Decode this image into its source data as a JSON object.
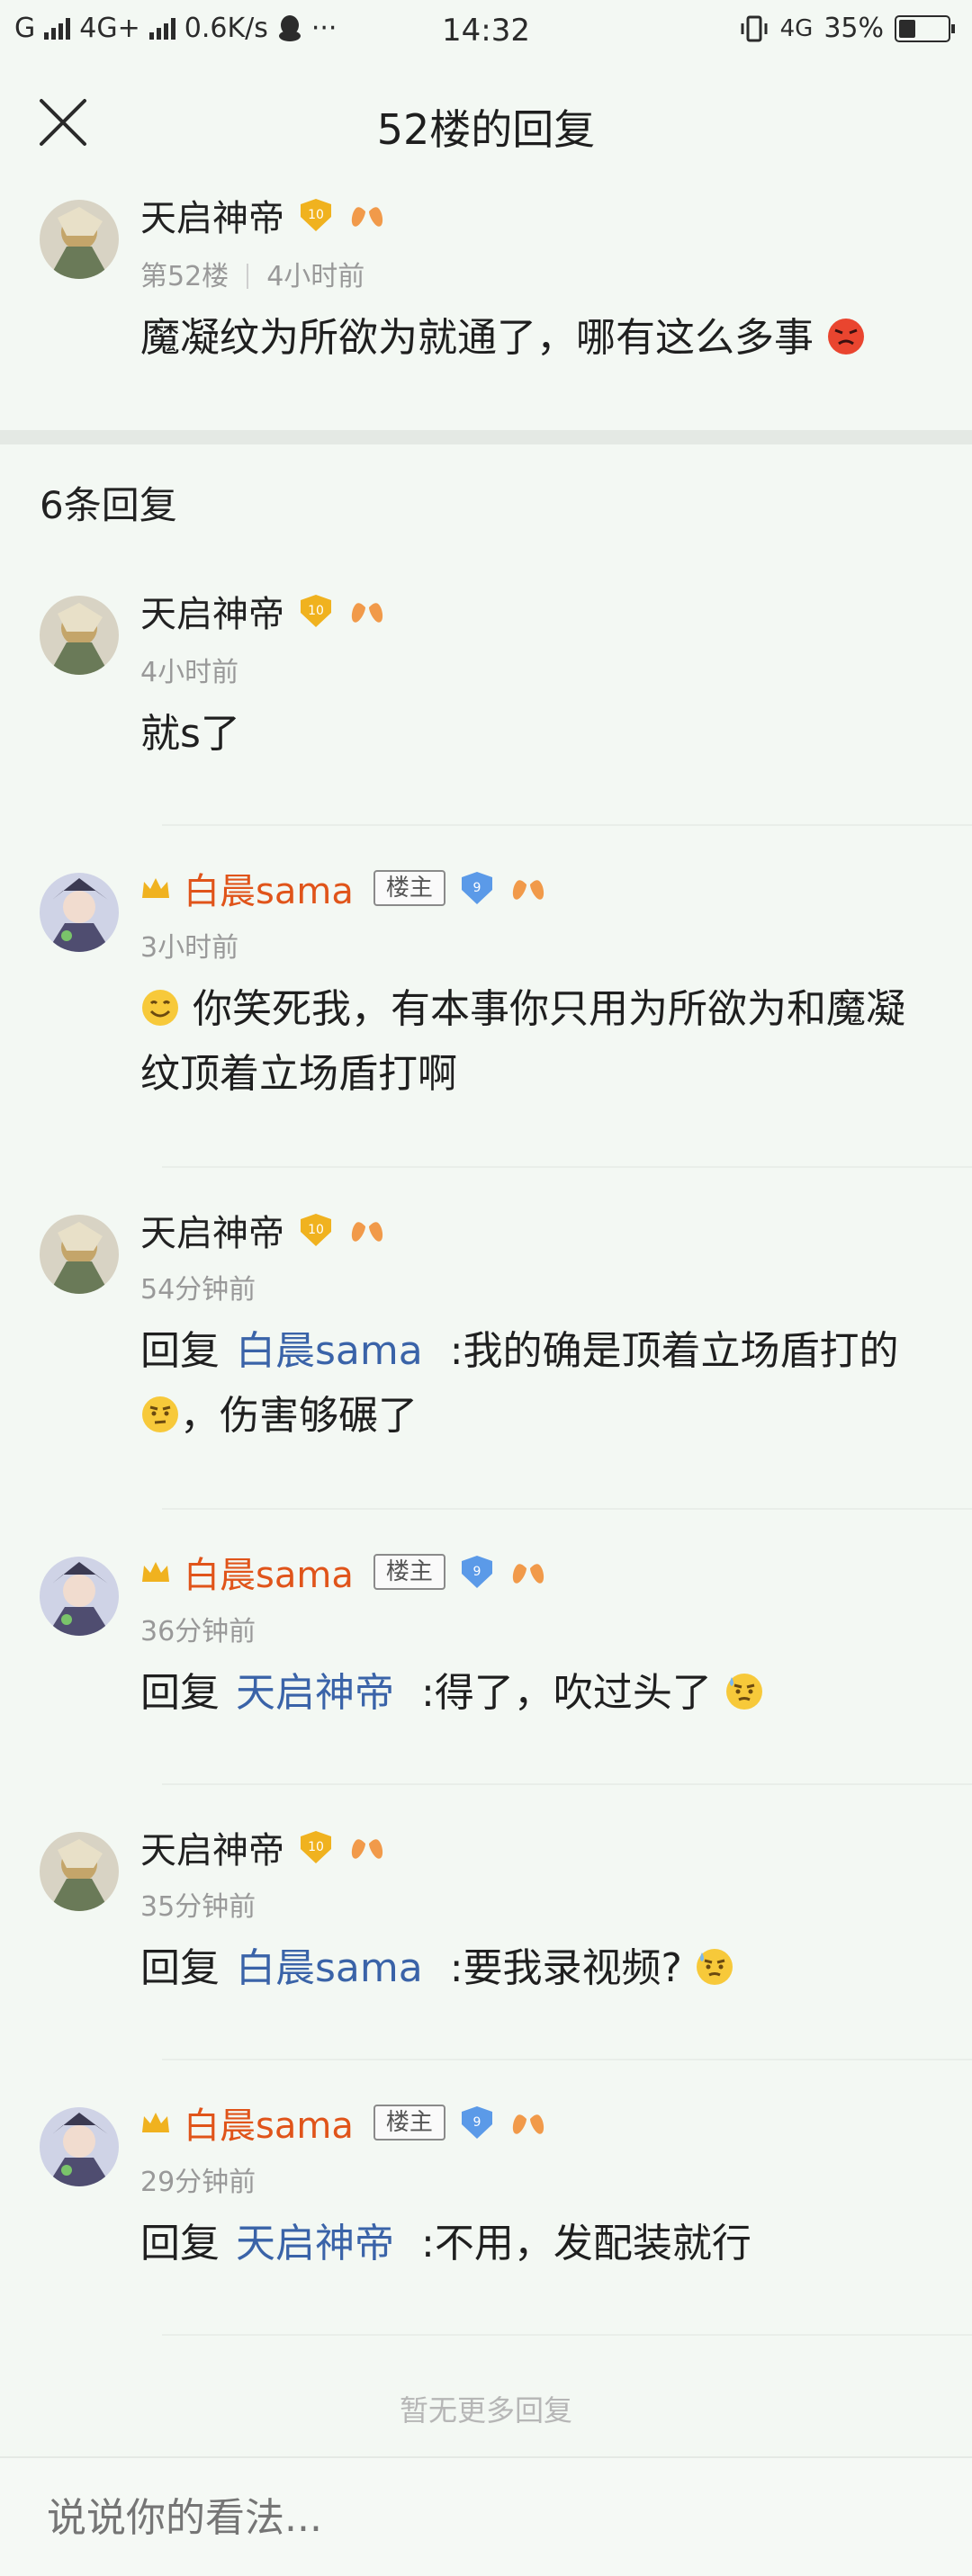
{
  "status_bar": {
    "left_text": "G",
    "network": "4G+",
    "speed": "0.6K/s",
    "more": "···",
    "time": "14:32",
    "net_right": "4G",
    "battery": "35%",
    "battery_level": 0.35
  },
  "nav": {
    "title": "52楼的回复",
    "close_icon": "close-icon"
  },
  "main_post": {
    "user": "天启神帝",
    "level": "10",
    "floor": "第52楼",
    "time": "4小时前",
    "content": "魔凝纹为所欲为就通了，哪有这么多事"
  },
  "reply_count": "6条回复",
  "labels": {
    "owner_tag": "楼主",
    "reply_word": "回复",
    "no_more": "暂无更多回复"
  },
  "replies": [
    {
      "user": "天启神帝",
      "owner": false,
      "level": "10",
      "time": "4小时前",
      "content": "就s了"
    },
    {
      "user": "白晨sama",
      "owner": true,
      "level": "9",
      "time": "3小时前",
      "content": "你笑死我，有本事你只用为所欲为和魔凝纹顶着立场盾打啊"
    },
    {
      "user": "天启神帝",
      "owner": false,
      "level": "10",
      "time": "54分钟前",
      "reply_to": "白晨sama",
      "content": ":我的确是顶着立场盾打的",
      "content_tail": "，伤害够碾了"
    },
    {
      "user": "白晨sama",
      "owner": true,
      "level": "9",
      "time": "36分钟前",
      "reply_to": "天启神帝",
      "content": ":得了，吹过头了"
    },
    {
      "user": "天启神帝",
      "owner": false,
      "level": "10",
      "time": "35分钟前",
      "reply_to": "白晨sama",
      "content": ":要我录视频?"
    },
    {
      "user": "白晨sama",
      "owner": true,
      "level": "9",
      "time": "29分钟前",
      "reply_to": "天启神帝",
      "content": ":不用，发配装就行"
    }
  ],
  "input": {
    "placeholder": "说说你的看法..."
  },
  "colors": {
    "background": "#f3f8f3",
    "owner_name": "#e0541a",
    "reply_target": "#3a63a8",
    "level_gold": "#f0b21f",
    "level_blue": "#5b9ae8",
    "meta_gray": "#999999"
  }
}
